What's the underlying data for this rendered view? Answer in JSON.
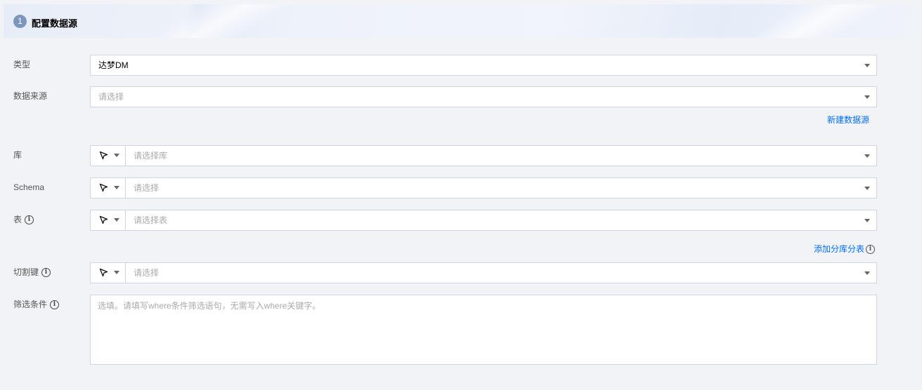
{
  "section": {
    "step": "1",
    "title": "配置数据源"
  },
  "fields": {
    "type": {
      "label": "类型",
      "value": "达梦DM"
    },
    "datasource": {
      "label": "数据来源",
      "placeholder": "请选择"
    },
    "new_datasource_link": "新建数据源",
    "database": {
      "label": "库",
      "placeholder": "请选择库"
    },
    "schema": {
      "label": "Schema",
      "placeholder": "请选择"
    },
    "table": {
      "label": "表",
      "placeholder": "请选择表"
    },
    "add_shard_link": "添加分库分表",
    "split_key": {
      "label": "切割键",
      "placeholder": "请选择"
    },
    "filter": {
      "label": "筛选条件",
      "placeholder": "选填。请填写where条件筛选语句，无需写入where关键字。"
    }
  },
  "icons": {
    "info": "info-circle-icon",
    "cursor": "cursor-arrow-icon",
    "dropdown": "caret-down-icon"
  },
  "colors": {
    "link": "#006eff",
    "step_badge": "#7d96be",
    "background": "#f2f3f6"
  }
}
